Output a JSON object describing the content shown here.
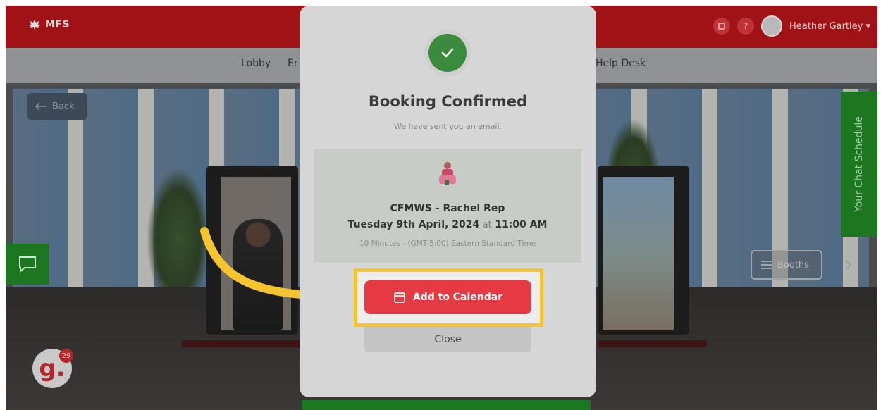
{
  "topbar": {
    "logo_text": "MFS",
    "help_label": "?",
    "user_name": "Heather Gartley ▾"
  },
  "nav": {
    "items": [
      "Lobby",
      "Er",
      "Help Desk"
    ]
  },
  "scene": {
    "back_label": "Back",
    "booths_label": "Booths",
    "chat_schedule_label": "Your Chat Schedule",
    "badge_letter": "g.",
    "badge_count": "29"
  },
  "modal": {
    "title": "Booking Confirmed",
    "subtitle": "We have sent you an email.",
    "rep_name": "CFMWS - Rachel Rep",
    "date": "Tuesday 9th April, 2024",
    "at": "at",
    "time": "11:00 AM",
    "duration": "10 Minutes - (GMT-5:00) Eastern Standard Time",
    "add_to_calendar_label": "Add to Calendar",
    "close_label": "Close"
  },
  "colors": {
    "topbar": "#a11217",
    "confirm_green": "#3a8b3e",
    "primary_button": "#e53a44",
    "highlight": "#f6c42f",
    "side_tab_green": "#1d7720"
  },
  "icons": [
    "check-icon",
    "calendar-icon",
    "back-arrow-icon",
    "list-icon",
    "chat-icon",
    "chevron-right-icon",
    "notification-icon",
    "maple-leaf-icon"
  ]
}
